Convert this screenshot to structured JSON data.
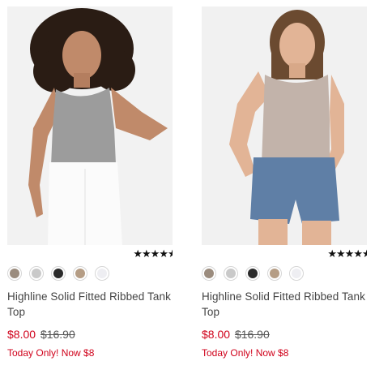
{
  "products": [
    {
      "name": "Highline Solid Fitted Ribbed Tank Top",
      "rating": 4.5,
      "rating_stars": "★★★★",
      "swatches": [
        "#9b8c7e",
        "#c9c9c9",
        "#2b2b2b",
        "#b59d85",
        "#eeeef2"
      ],
      "sale_price": "$8.00",
      "original_price": "$16.90",
      "promo": "Today Only! Now $8",
      "image_alt": "woman in grey ribbed tank top and white jeans"
    },
    {
      "name": "Highline Solid Fitted Ribbed Tank Top",
      "rating": 4.5,
      "rating_stars": "★★★★",
      "swatches": [
        "#9b8c7e",
        "#c9c9c9",
        "#2b2b2b",
        "#b59d85",
        "#eeeef2"
      ],
      "sale_price": "$8.00",
      "original_price": "$16.90",
      "promo": "Today Only! Now $8",
      "image_alt": "woman in beige ribbed tank top and denim shorts"
    }
  ]
}
